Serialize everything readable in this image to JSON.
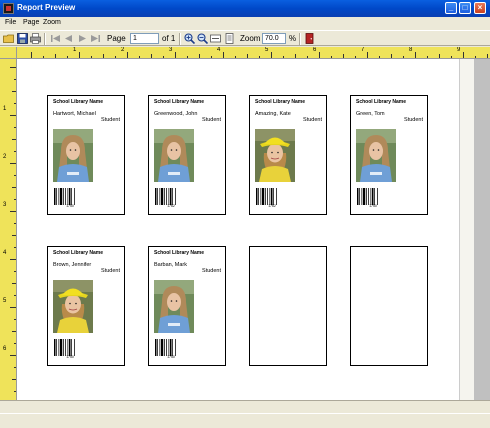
{
  "window": {
    "title": "Report Preview"
  },
  "menu": [
    "File",
    "Page",
    "Zoom"
  ],
  "toolbar": {
    "page_label": "Page",
    "page_value": "1",
    "of_label": "of 1",
    "zoom_label": "Zoom",
    "zoom_value": "70.0",
    "percent_label": "%"
  },
  "ruler": {
    "top": [
      "1",
      "2",
      "3",
      "4",
      "5",
      "6",
      "7",
      "8",
      "9",
      "10"
    ],
    "left": [
      "1",
      "2",
      "3",
      "4",
      "5",
      "6",
      "7",
      "8"
    ]
  },
  "cards": [
    {
      "library": "School Library Name",
      "name": "Hartwort, Michael",
      "role": "Student",
      "photo": "long-hair-boy",
      "barcode_text": "1750"
    },
    {
      "library": "School Library Name",
      "name": "Greenwood, John",
      "role": "Student",
      "photo": "long-hair-boy",
      "barcode_text": "1762"
    },
    {
      "library": "School Library Name",
      "name": "Amazing, Kate",
      "role": "Student",
      "photo": "girl-yellow-hat",
      "barcode_text": "1762"
    },
    {
      "library": "School Library Name",
      "name": "Green, Tom",
      "role": "Student",
      "photo": "long-hair-boy",
      "barcode_text": "1750"
    },
    {
      "library": "School Library Name",
      "name": "Brown, Jennifer",
      "role": "Student",
      "photo": "girl-yellow-hat",
      "barcode_text": "1750"
    },
    {
      "library": "School Library Name",
      "name": "Barban,  Mark",
      "role": "Student",
      "photo": "long-hair-boy",
      "barcode_text": "1750"
    },
    {
      "library": "",
      "name": "",
      "role": "",
      "photo": "",
      "barcode_text": ""
    },
    {
      "library": "",
      "name": "",
      "role": "",
      "photo": "",
      "barcode_text": ""
    }
  ]
}
